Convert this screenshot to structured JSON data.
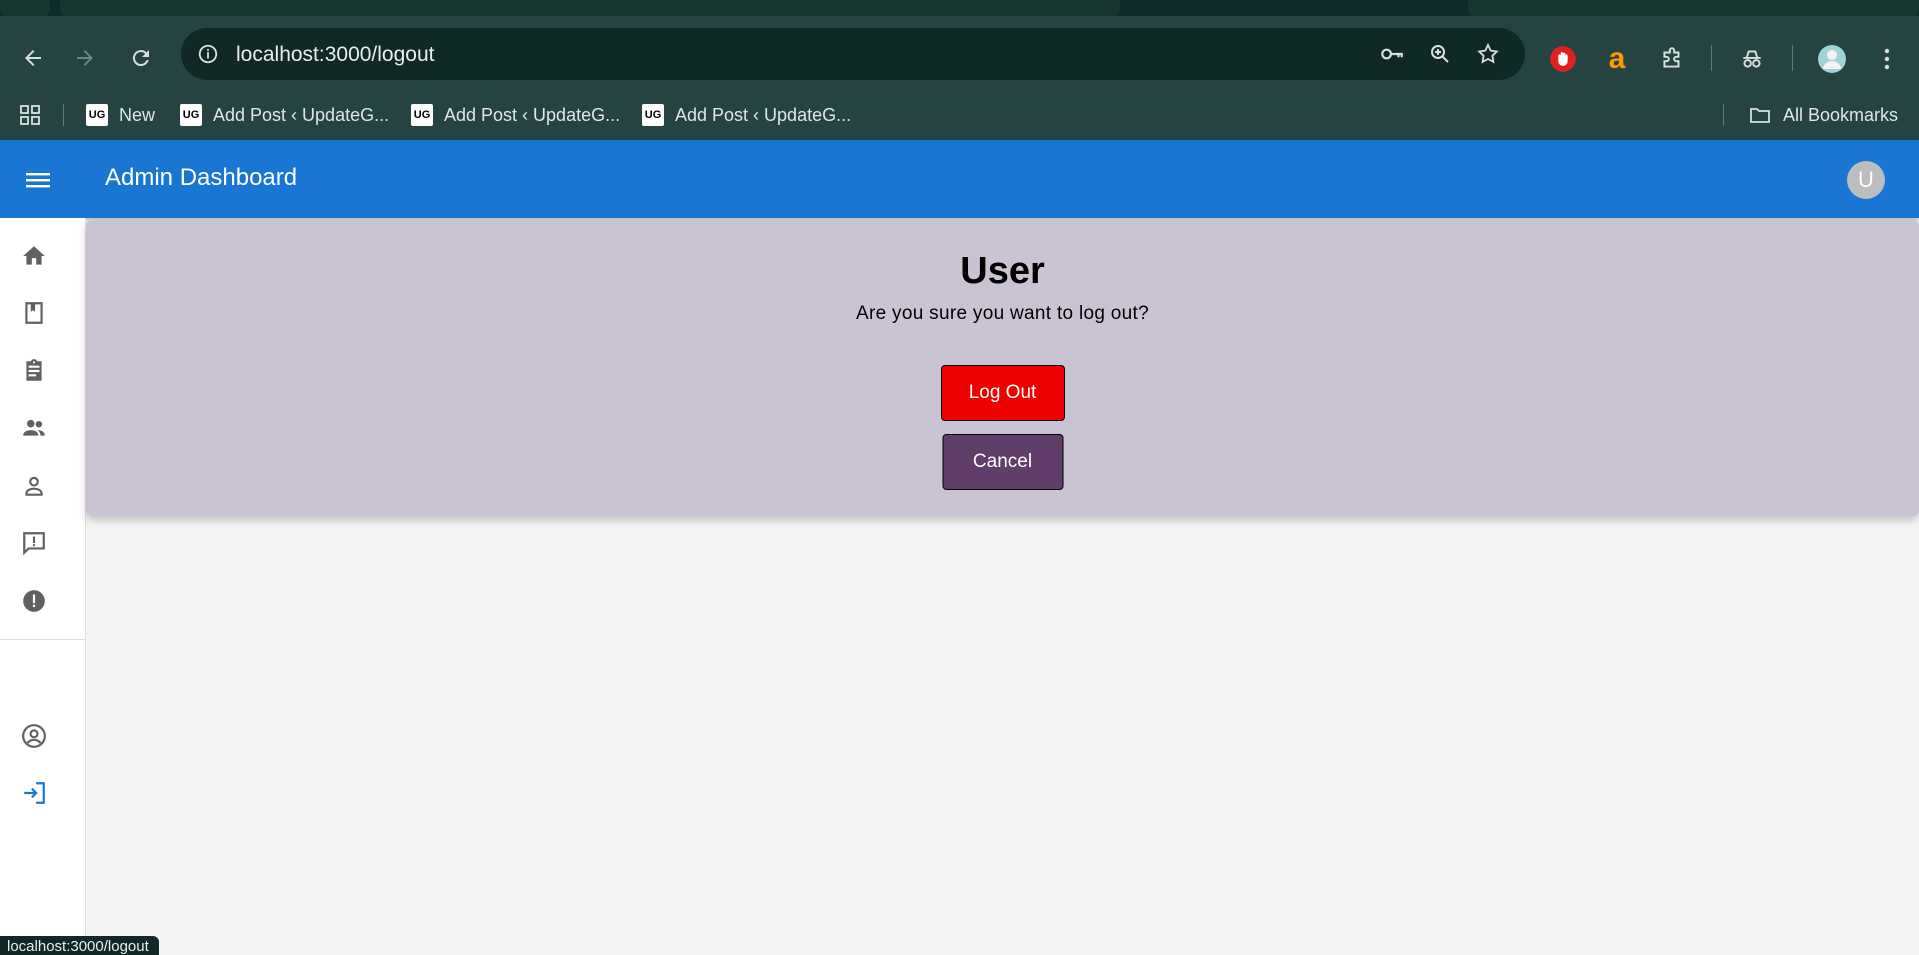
{
  "browser": {
    "url": "localhost:3000/logout",
    "bookmarks": [
      {
        "label": "New",
        "favicon": "UG"
      },
      {
        "label": "Add Post ‹ UpdateG...",
        "favicon": "UG"
      },
      {
        "label": "Add Post ‹ UpdateG...",
        "favicon": "UG"
      },
      {
        "label": "Add Post ‹ UpdateG...",
        "favicon": "UG"
      }
    ],
    "all_bookmarks_label": "All Bookmarks",
    "status_text": "localhost:3000/logout",
    "ext_amazon_glyph": "a"
  },
  "app": {
    "title": "Admin Dashboard",
    "avatar_initial": "U",
    "brand_color": "#1976d2"
  },
  "sidebar": {
    "items": [
      "home-icon",
      "bookmark-icon",
      "assignment-icon",
      "group-icon",
      "person-icon",
      "feedback-icon",
      "error-icon",
      "account-circle-icon",
      "login-icon"
    ]
  },
  "logout": {
    "heading": "User",
    "message": "Are you sure you want to log out?",
    "logout_label": "Log Out",
    "cancel_label": "Cancel",
    "logout_color": "#ee0000",
    "cancel_color": "#613d6a"
  }
}
